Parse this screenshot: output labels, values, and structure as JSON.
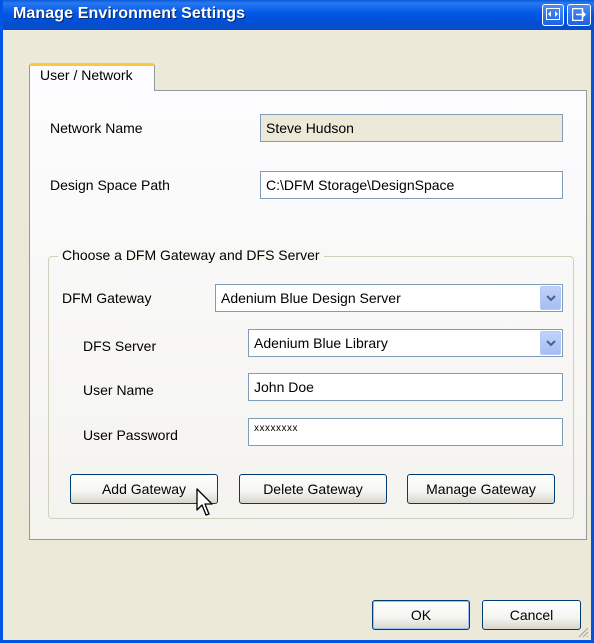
{
  "window": {
    "title": "Manage Environment Settings"
  },
  "tabs": [
    {
      "label": "User / Network"
    }
  ],
  "network_name": {
    "label": "Network Name",
    "value": "Steve Hudson"
  },
  "design_space_path": {
    "label": "Design Space Path",
    "value": "C:\\DFM Storage\\DesignSpace"
  },
  "gateway_group": {
    "caption": "Choose a DFM Gateway and DFS Server",
    "dfm_gateway": {
      "label": "DFM Gateway",
      "selected": "Adenium Blue Design Server"
    },
    "dfs_server": {
      "label": "DFS Server",
      "selected": "Adenium Blue Library"
    },
    "user_name": {
      "label": "User Name",
      "value": "John Doe"
    },
    "user_password": {
      "label": "User Password",
      "value": "xxxxxxxx"
    },
    "buttons": {
      "add": "Add Gateway",
      "delete": "Delete Gateway",
      "manage": "Manage Gateway"
    }
  },
  "dialog_buttons": {
    "ok": "OK",
    "cancel": "Cancel"
  },
  "icons": {
    "titlebar_left": "expand-horizontal-icon",
    "titlebar_right": "window-export-icon",
    "combo_arrow": "chevron-down-icon",
    "cursor": "mouse-pointer-icon",
    "grip": "resize-grip-icon"
  },
  "colors": {
    "titlebar": "#0058e6",
    "window_bg": "#ece9d8",
    "tab_highlight": "#ffc83c",
    "field_border": "#7f9db9",
    "button_border": "#003c74"
  }
}
